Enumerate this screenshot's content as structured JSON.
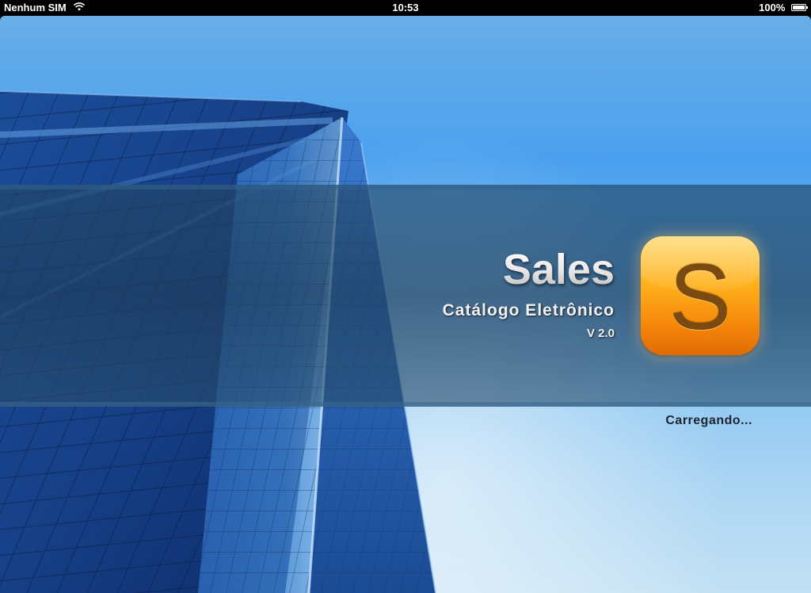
{
  "status_bar": {
    "carrier": "Nenhum SIM",
    "time": "10:53",
    "battery_percent": "100%",
    "battery_level": 1.0,
    "wifi_icon": "wifi-icon",
    "battery_icon": "battery-icon"
  },
  "splash": {
    "title": "Sales",
    "subtitle": "Catálogo Eletrônico",
    "version": "V 2.0",
    "icon_letter": "S",
    "loading_text": "Carregando..."
  },
  "colors": {
    "icon_orange": "#ffb11c",
    "sky_blue": "#4aa0ee",
    "banner": "#2a4f72"
  }
}
